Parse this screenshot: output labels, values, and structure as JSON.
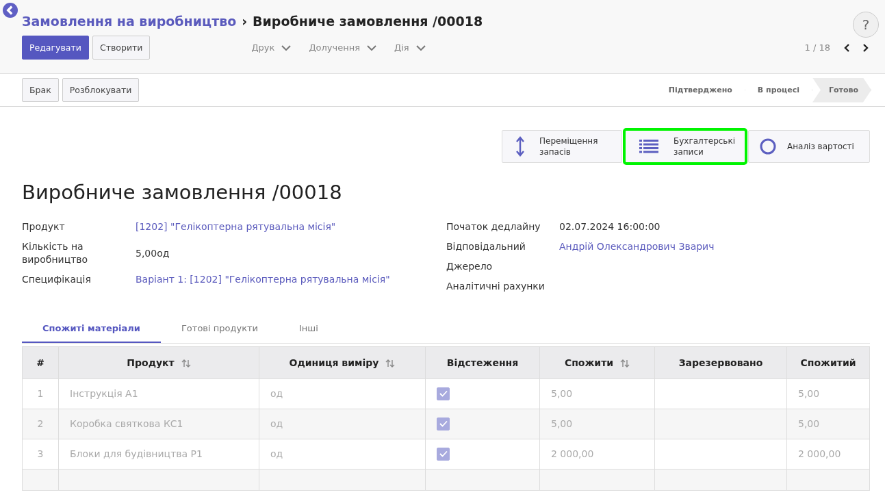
{
  "breadcrumb": {
    "parent": "Замовлення на виробництво",
    "separator": "›",
    "current": "Виробниче замовлення /00018"
  },
  "help": "?",
  "buttons": [
    {
      "label": "Редагувати",
      "primary": true
    },
    {
      "label": "Створити",
      "primary": false
    }
  ],
  "menus": [
    "Друк",
    "Долучення",
    "Дія"
  ],
  "pager": {
    "text": "1 / 18"
  },
  "actions": [
    "Брак",
    "Розблокувати"
  ],
  "stages": [
    {
      "label": "Підтверджено",
      "selected": false
    },
    {
      "label": "В процесі",
      "selected": false
    },
    {
      "label": "Готово",
      "selected": true
    }
  ],
  "stat_buttons": [
    {
      "kind": "arrows",
      "label": "Переміщення запасів",
      "highlighted": false
    },
    {
      "kind": "list",
      "label": "Бухгалтерські записи",
      "highlighted": true
    },
    {
      "kind": "circle",
      "label": "Аналіз вартості",
      "highlighted": false
    }
  ],
  "title": "Виробниче замовлення /00018",
  "left_fields": [
    {
      "label": "Продукт",
      "value": "[1202] \"Гелікоптерна рятувальна місія\"",
      "link": true
    },
    {
      "label": "Кількість на виробництво",
      "value": "5,00од",
      "link": false
    },
    {
      "label": "Специфікація",
      "value": "Варіант 1: [1202] \"Гелікоптерна рятувальна місія\"",
      "link": true
    }
  ],
  "right_fields": [
    {
      "label": "Початок дедлайну",
      "value": "02.07.2024 16:00:00",
      "link": false
    },
    {
      "label": "Відповідальний",
      "value": "Андрій Олександрович Зварич",
      "link": true
    },
    {
      "label": "Джерело"
    },
    {
      "label": "Аналітичні рахунки"
    }
  ],
  "tabs": [
    {
      "label": "Спожиті матеріали",
      "selected": true
    },
    {
      "label": "Готові продукти",
      "selected": false
    },
    {
      "label": "Інші",
      "selected": false
    }
  ],
  "table": {
    "columns": [
      {
        "label": "#",
        "sortable": false
      },
      {
        "label": "Продукт",
        "sortable": true
      },
      {
        "label": "Одиниця виміру",
        "sortable": true
      },
      {
        "label": "Відстеження",
        "sortable": false
      },
      {
        "label": "Спожити",
        "sortable": true
      },
      {
        "label": "Зарезервовано",
        "sortable": false
      },
      {
        "label": "Спожитий",
        "sortable": false
      }
    ],
    "rows": [
      {
        "num": "1",
        "product": "Інструкція А1",
        "uom": "од",
        "tracked": true,
        "to_consume": "5,00",
        "consumed": "5,00"
      },
      {
        "num": "2",
        "product": "Коробка святкова КС1",
        "uom": "од",
        "tracked": true,
        "to_consume": "5,00",
        "consumed": "5,00"
      },
      {
        "num": "3",
        "product": "Блоки для будівництва Р1",
        "uom": "од",
        "tracked": true,
        "to_consume": "2 000,00",
        "consumed": "2 000,00"
      }
    ]
  }
}
